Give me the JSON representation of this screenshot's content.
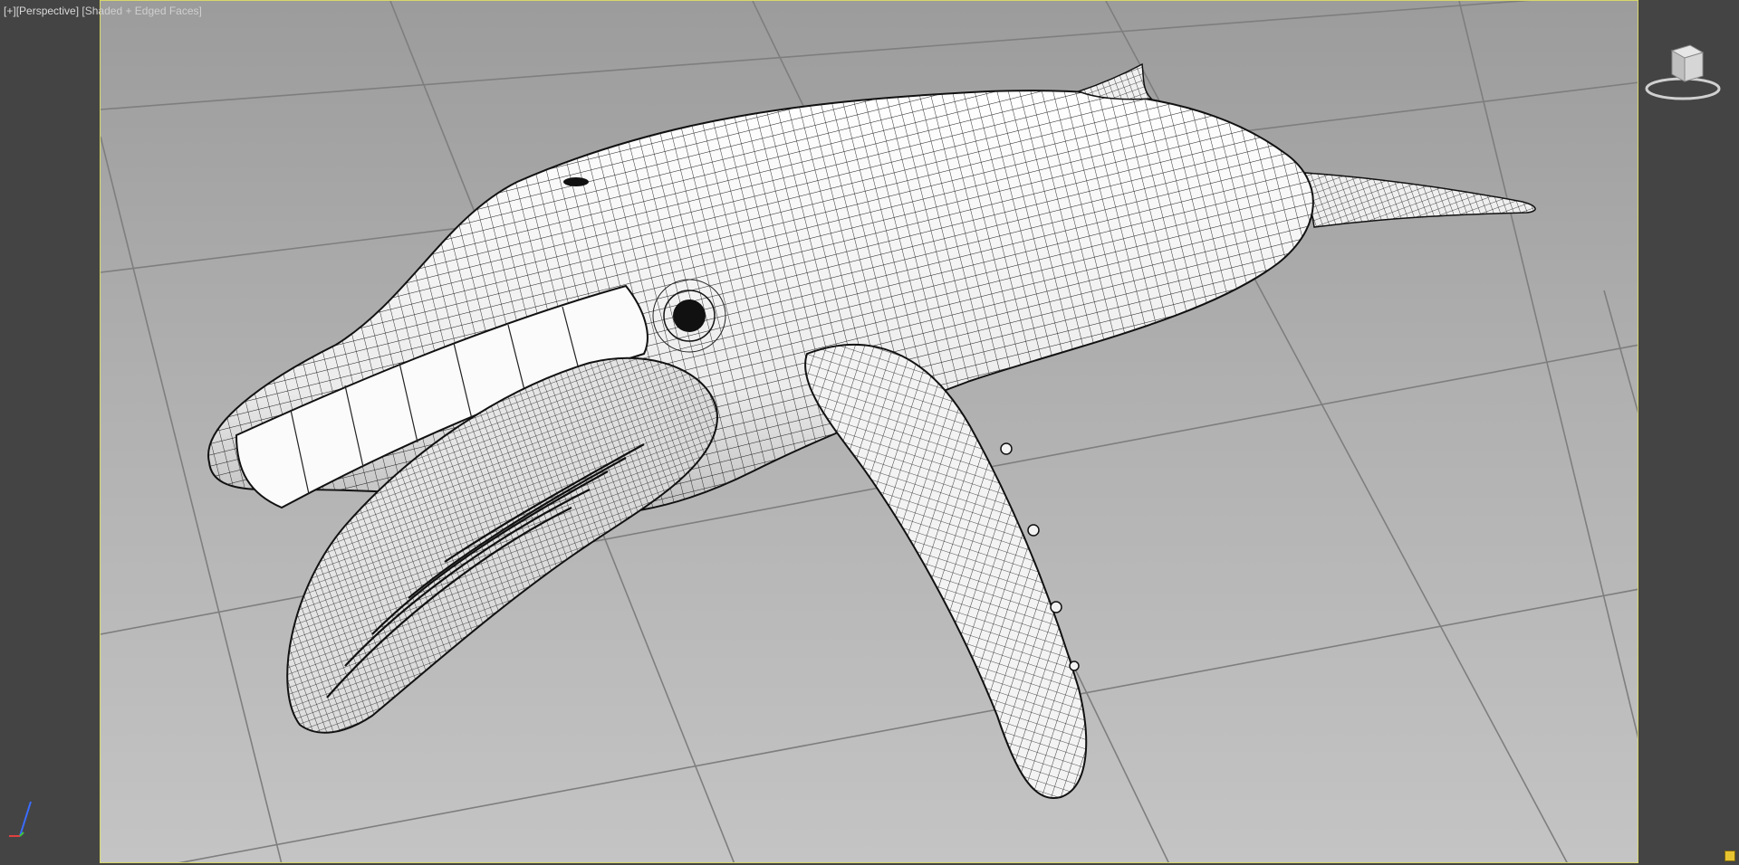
{
  "viewport": {
    "plus_label": "[+]",
    "view_label": "[Perspective]",
    "shading_label": "[Shaded + Edged Faces]"
  },
  "icons": {
    "viewcube": "viewcube-icon",
    "axis": "axis-tripod-icon",
    "corner": "viewport-badge-icon"
  },
  "colors": {
    "ui_background": "#444444",
    "viewport_border": "#d8d86a",
    "grid_line": "#7e7e7e",
    "mesh_fill": "#f2f2f2",
    "wire": "#1a1a1a"
  }
}
